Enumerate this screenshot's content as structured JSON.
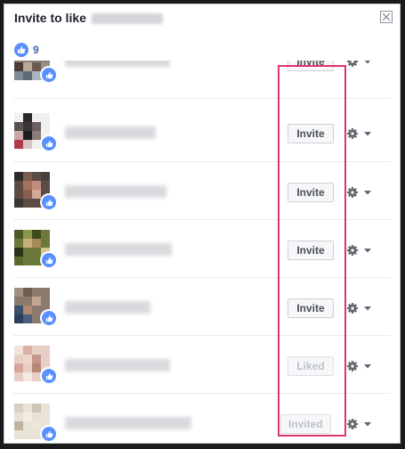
{
  "dialog": {
    "title": "Invite to like",
    "close_icon": "close-icon"
  },
  "likes": {
    "icon": "thumbs-up-icon",
    "count": "9"
  },
  "colors": {
    "accent": "#5890ff",
    "highlight": "#e0336f",
    "like_count": "#4267b2"
  },
  "rows": [
    {
      "action": "Invite",
      "state": "enabled"
    },
    {
      "action": "Invite",
      "state": "enabled"
    },
    {
      "action": "Invite",
      "state": "enabled"
    },
    {
      "action": "Invite",
      "state": "enabled"
    },
    {
      "action": "Invite",
      "state": "enabled"
    },
    {
      "action": "Liked",
      "state": "disabled"
    },
    {
      "action": "Invited",
      "state": "disabled"
    }
  ]
}
